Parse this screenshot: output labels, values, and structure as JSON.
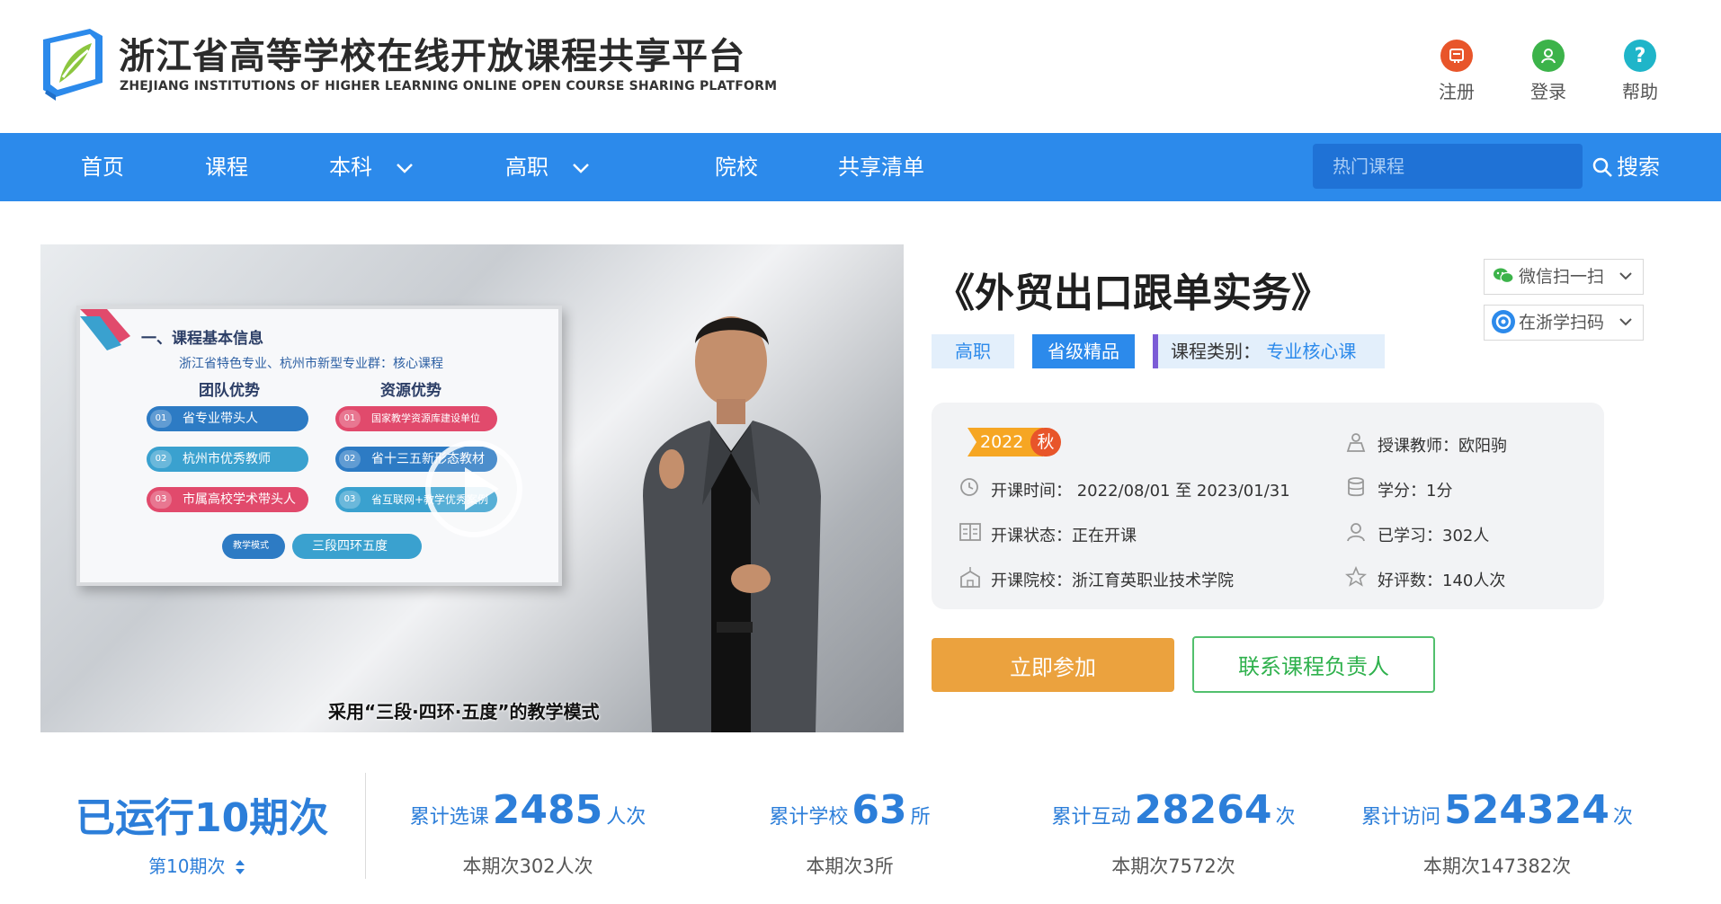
{
  "header": {
    "title": "浙江省高等学校在线开放课程共享平台",
    "subtitle": "ZHEJIANG INSTITUTIONS OF HIGHER LEARNING ONLINE OPEN COURSE SHARING PLATFORM",
    "actions": [
      {
        "label": "注册",
        "icon": "register-icon",
        "color": "#e8552a"
      },
      {
        "label": "登录",
        "icon": "login-user-icon",
        "color": "#3cb34a"
      },
      {
        "label": "帮助",
        "icon": "help-icon",
        "color": "#1fb5c9"
      }
    ]
  },
  "nav": {
    "items": [
      "首页",
      "课程",
      "本科",
      "高职",
      "院校",
      "共享清单"
    ],
    "search_placeholder": "热门课程",
    "search_label": "搜索",
    "color": "#2c8aeb"
  },
  "video": {
    "slide_title": "一、课程基本信息",
    "slide_subtitle": "浙江省特色专业、杭州市新型专业群：核心课程",
    "col_left": "团队优势",
    "col_right": "资源优势",
    "left_items": [
      {
        "num": "01",
        "text": "省专业带头人"
      },
      {
        "num": "02",
        "text": "杭州市优秀教师"
      },
      {
        "num": "03",
        "text": "市属高校学术带头人"
      }
    ],
    "right_items": [
      {
        "num": "01",
        "text": "国家教学资源库建设单位"
      },
      {
        "num": "02",
        "text": "省十三五新形态教材"
      },
      {
        "num": "03",
        "text": "省互联网+教学优秀案例"
      }
    ],
    "mode_label": "教学模式",
    "mode_value": "三段四环五度",
    "caption": "采用“三段·四环·五度”的教学模式"
  },
  "course": {
    "title": "《外贸出口跟单实务》",
    "tags": [
      "高职",
      "省级精品"
    ],
    "category_label": "课程类别：",
    "category_value": "专业核心课",
    "share": [
      "微信扫一扫",
      "在浙学扫码"
    ],
    "semester_year": "2022",
    "semester_season": "秋",
    "info": {
      "time": "开课时间：  2022/08/01 至 2023/01/31",
      "status": "开课状态：正在开课",
      "school": "开课院校：浙江育英职业技术学院",
      "teacher": "授课教师：欧阳驹",
      "credit": "学分：1分",
      "learners": "已学习：302人",
      "rating": "好评数：140人次"
    },
    "join_label": "立即参加",
    "contact_label": "联系课程负责人"
  },
  "stats": {
    "run_title": "已运行10期次",
    "period": "第10期次",
    "items": [
      {
        "label": "累计选课",
        "num": "2485",
        "unit": "人次",
        "sub": "本期次302人次"
      },
      {
        "label": "累计学校",
        "num": "63",
        "unit": "所",
        "sub": "本期次3所"
      },
      {
        "label": "累计互动",
        "num": "28264",
        "unit": "次",
        "sub": "本期次7572次"
      },
      {
        "label": "累计访问",
        "num": "524324",
        "unit": "次",
        "sub": "本期次147382次"
      }
    ]
  }
}
